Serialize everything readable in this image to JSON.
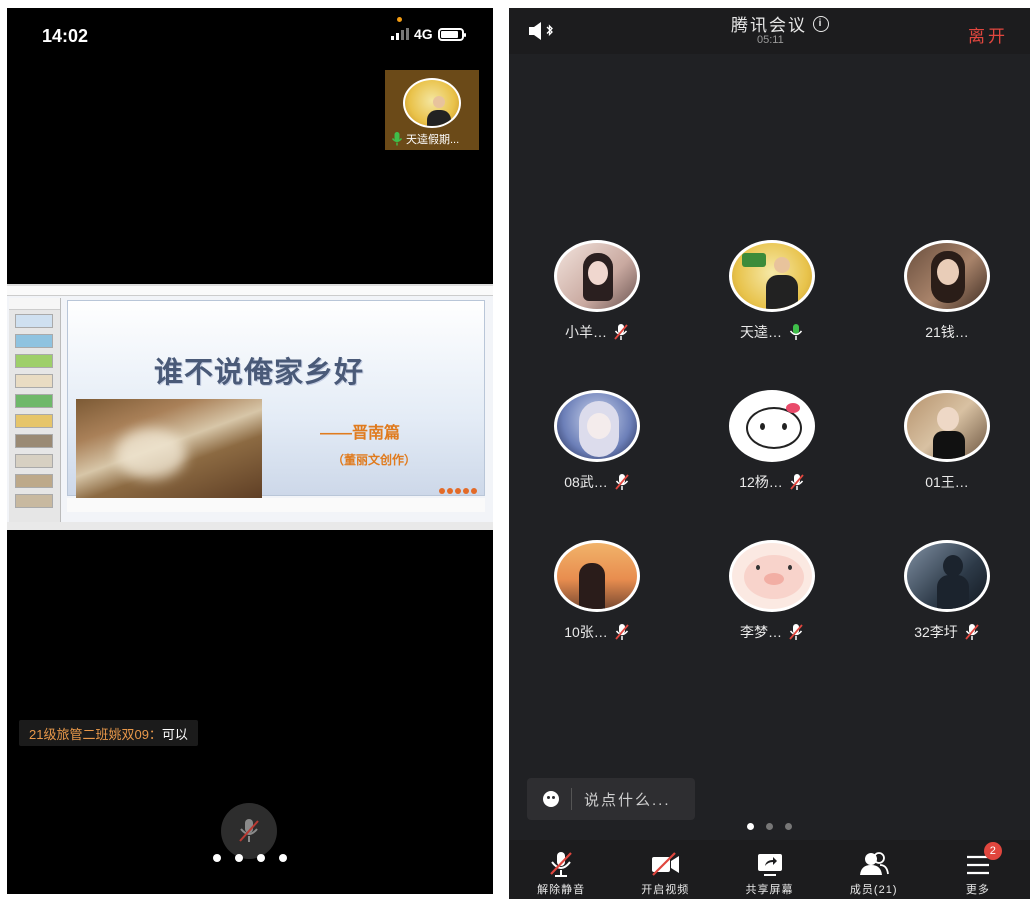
{
  "left_screen": {
    "status_time": "14:02",
    "network": "4G",
    "pip_name": "天逵假期...",
    "slide": {
      "title": "谁不说俺家乡好",
      "subtitle": "——晋南篇",
      "subtitle2": "（董丽文创作）"
    },
    "chat": {
      "sender": "21级旅管二班姚双09：",
      "text": "可以"
    },
    "page_dots": 4
  },
  "right_screen": {
    "app_title": "腾讯会议",
    "meeting_time": "05:11",
    "leave_label": "离开",
    "members": [
      {
        "name": "小羊…",
        "mic": "muted"
      },
      {
        "name": "天逵…",
        "mic": "on"
      },
      {
        "name": "21钱…",
        "mic": "none"
      },
      {
        "name": "08武…",
        "mic": "muted"
      },
      {
        "name": "12杨…",
        "mic": "muted"
      },
      {
        "name": "01王…",
        "mic": "none"
      },
      {
        "name": "10张…",
        "mic": "muted"
      },
      {
        "name": "李梦…",
        "mic": "muted"
      },
      {
        "name": "32李圩",
        "mic": "muted"
      }
    ],
    "input_placeholder": "说点什么...",
    "toolbar": {
      "unmute": "解除静音",
      "video": "开启视频",
      "share": "共享屏幕",
      "members": "成员(21)",
      "more": "更多",
      "more_badge": "2"
    },
    "colors": {
      "leave": "#e0463e",
      "mic_on": "#3fbf4a",
      "mic_muted": "#e0463e",
      "background": "#202124"
    }
  }
}
